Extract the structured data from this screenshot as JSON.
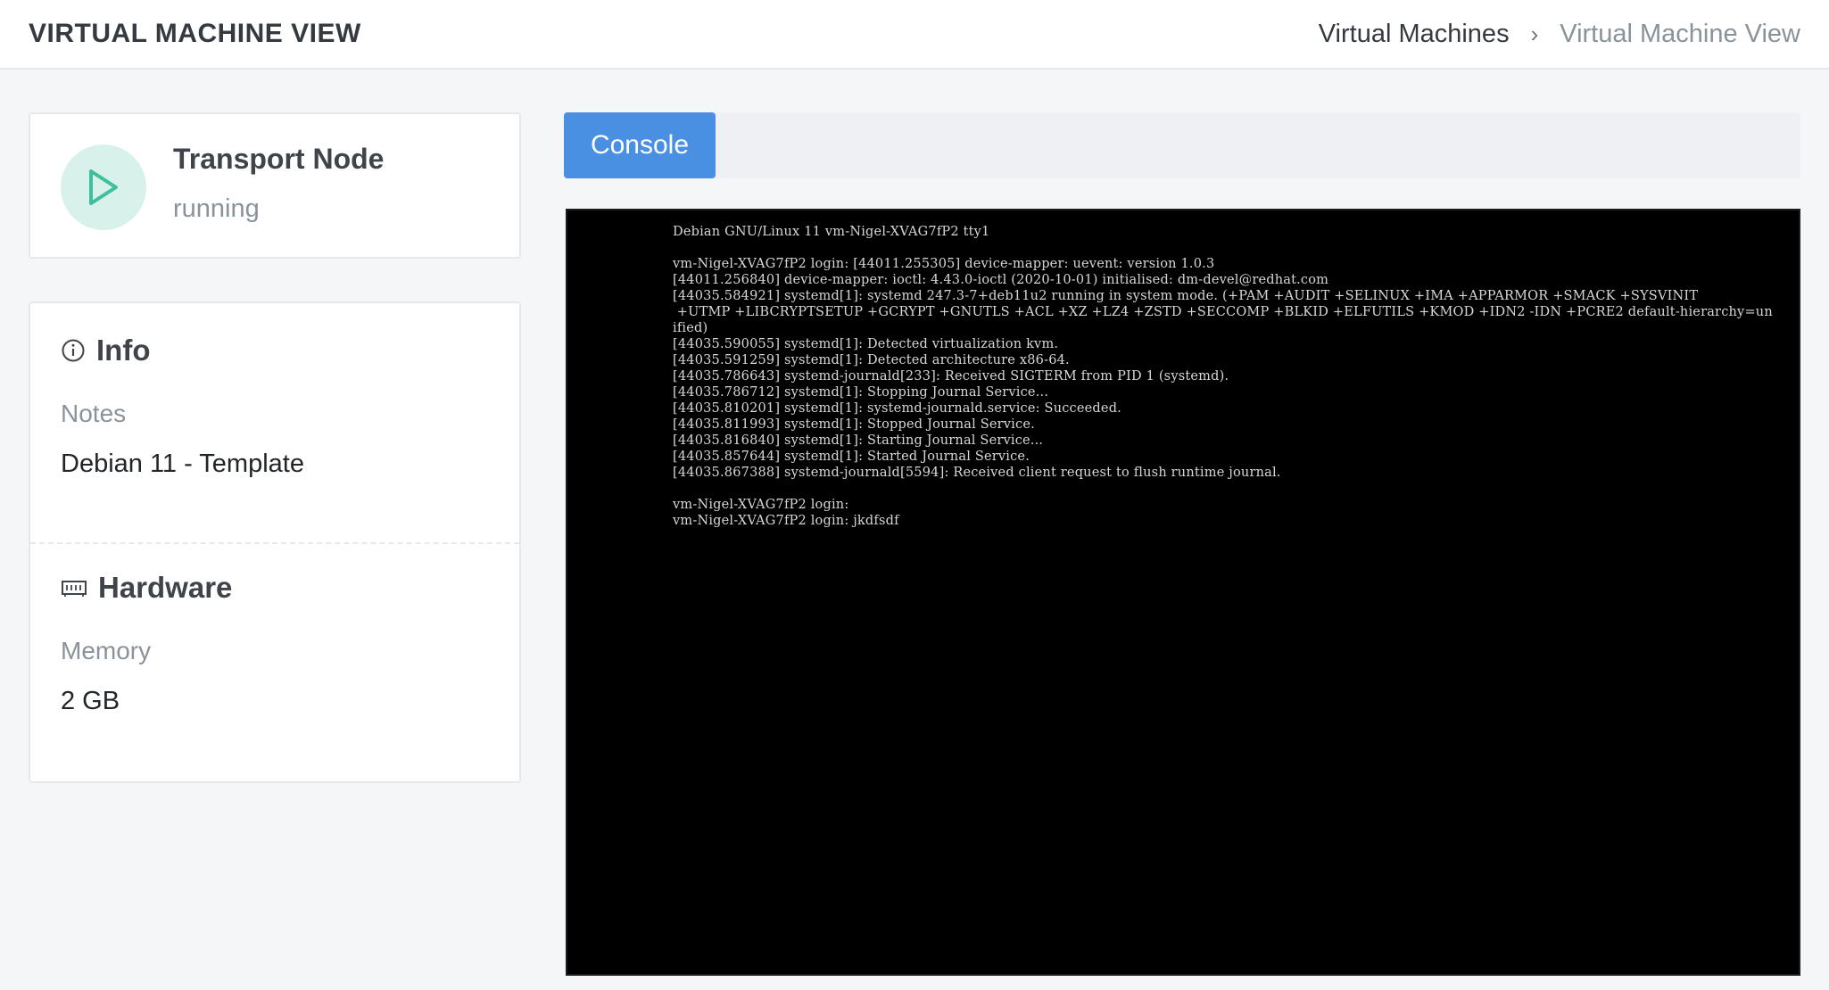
{
  "header": {
    "title": "VIRTUAL MACHINE VIEW",
    "breadcrumb": {
      "parent": "Virtual Machines",
      "current": "Virtual Machine View"
    }
  },
  "vm": {
    "name": "Transport Node",
    "status": "running",
    "status_color": "#3fbf9f"
  },
  "info": {
    "title": "Info",
    "notes_label": "Notes",
    "notes_value": "Debian 11 - Template"
  },
  "hardware": {
    "title": "Hardware",
    "memory_label": "Memory",
    "memory_value": "2 GB"
  },
  "tabs": {
    "console_label": "Console"
  },
  "console": {
    "lines": [
      "Debian GNU/Linux 11 vm-Nigel-XVAG7fP2 tty1",
      "",
      "vm-Nigel-XVAG7fP2 login: [44011.255305] device-mapper: uevent: version 1.0.3",
      "[44011.256840] device-mapper: ioctl: 4.43.0-ioctl (2020-10-01) initialised: dm-devel@redhat.com",
      "[44035.584921] systemd[1]: systemd 247.3-7+deb11u2 running in system mode. (+PAM +AUDIT +SELINUX +IMA +APPARMOR +SMACK +SYSVINIT",
      " +UTMP +LIBCRYPTSETUP +GCRYPT +GNUTLS +ACL +XZ +LZ4 +ZSTD +SECCOMP +BLKID +ELFUTILS +KMOD +IDN2 -IDN +PCRE2 default-hierarchy=un",
      "ified)",
      "[44035.590055] systemd[1]: Detected virtualization kvm.",
      "[44035.591259] systemd[1]: Detected architecture x86-64.",
      "[44035.786643] systemd-journald[233]: Received SIGTERM from PID 1 (systemd).",
      "[44035.786712] systemd[1]: Stopping Journal Service...",
      "[44035.810201] systemd[1]: systemd-journald.service: Succeeded.",
      "[44035.811993] systemd[1]: Stopped Journal Service.",
      "[44035.816840] systemd[1]: Starting Journal Service...",
      "[44035.857644] systemd[1]: Started Journal Service.",
      "[44035.867388] systemd-journald[5594]: Received client request to flush runtime journal.",
      "",
      "vm-Nigel-XVAG7fP2 login:",
      "vm-Nigel-XVAG7fP2 login: jkdfsdf"
    ]
  }
}
